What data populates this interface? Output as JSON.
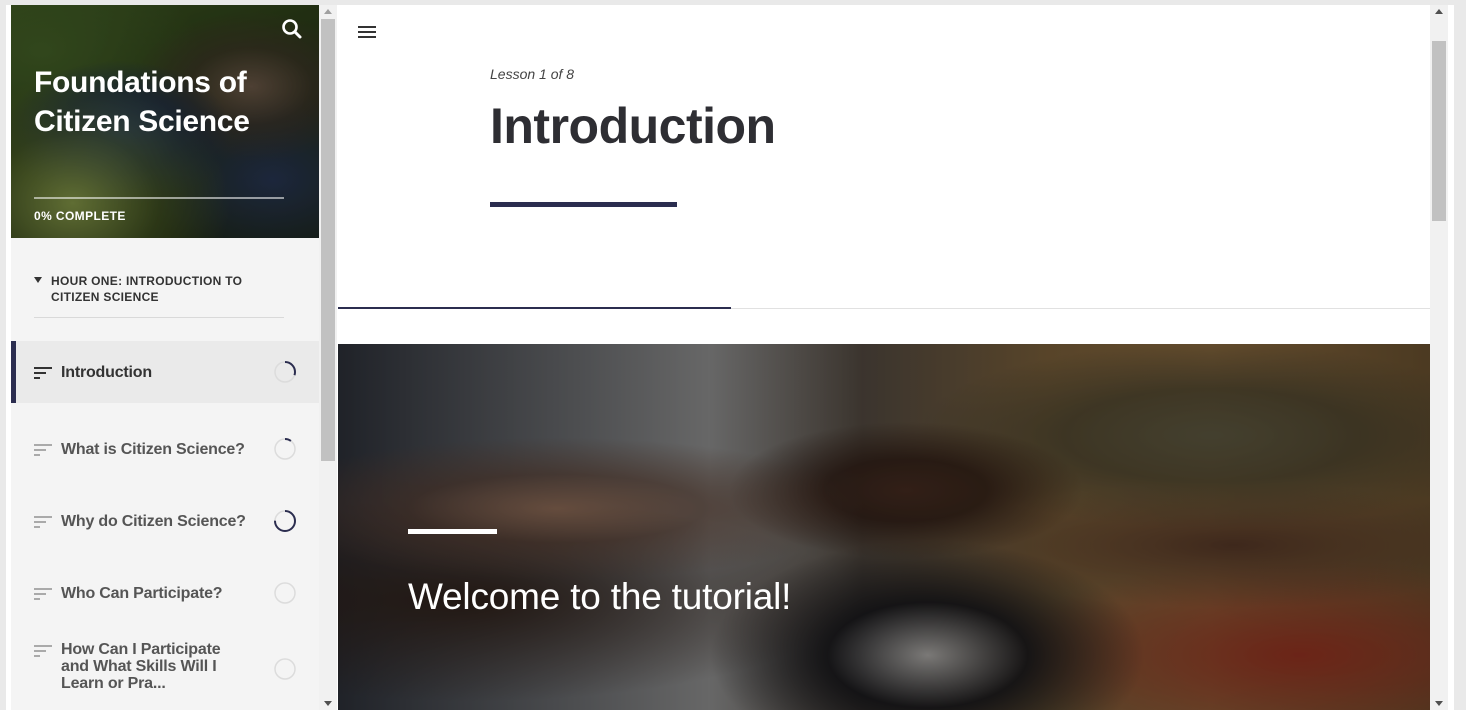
{
  "course": {
    "title": "Foundations of Citizen Science",
    "progress_label": "0% COMPLETE",
    "progress_percent": 0
  },
  "sidebar": {
    "section_title": "HOUR ONE: INTRODUCTION TO CITIZEN SCIENCE",
    "lessons": [
      {
        "label": "Introduction",
        "status_progress": 0.3,
        "active": true
      },
      {
        "label": "What is Citizen Science?",
        "status_progress": 0.1
      },
      {
        "label": "Why do Citizen Science?",
        "status_progress": 0.75
      },
      {
        "label": "Who Can Participate?",
        "status_progress": 0
      },
      {
        "label": "How Can I Participate and What Skills Will I Learn or Pra...",
        "status_progress": 0
      }
    ]
  },
  "main": {
    "lesson_counter": "Lesson 1 of 8",
    "lesson_title": "Introduction",
    "hero_text": "Welcome to the tutorial!",
    "lesson_progress_fraction": 0.36
  },
  "colors": {
    "accent": "#2b2d4f",
    "sidebar_bg": "#f4f4f4"
  },
  "icons": {
    "search": "search-icon",
    "menu": "hamburger-menu-icon",
    "lesson": "text-lines-icon",
    "status": "progress-ring-icon",
    "section_toggle": "caret-down-icon"
  }
}
